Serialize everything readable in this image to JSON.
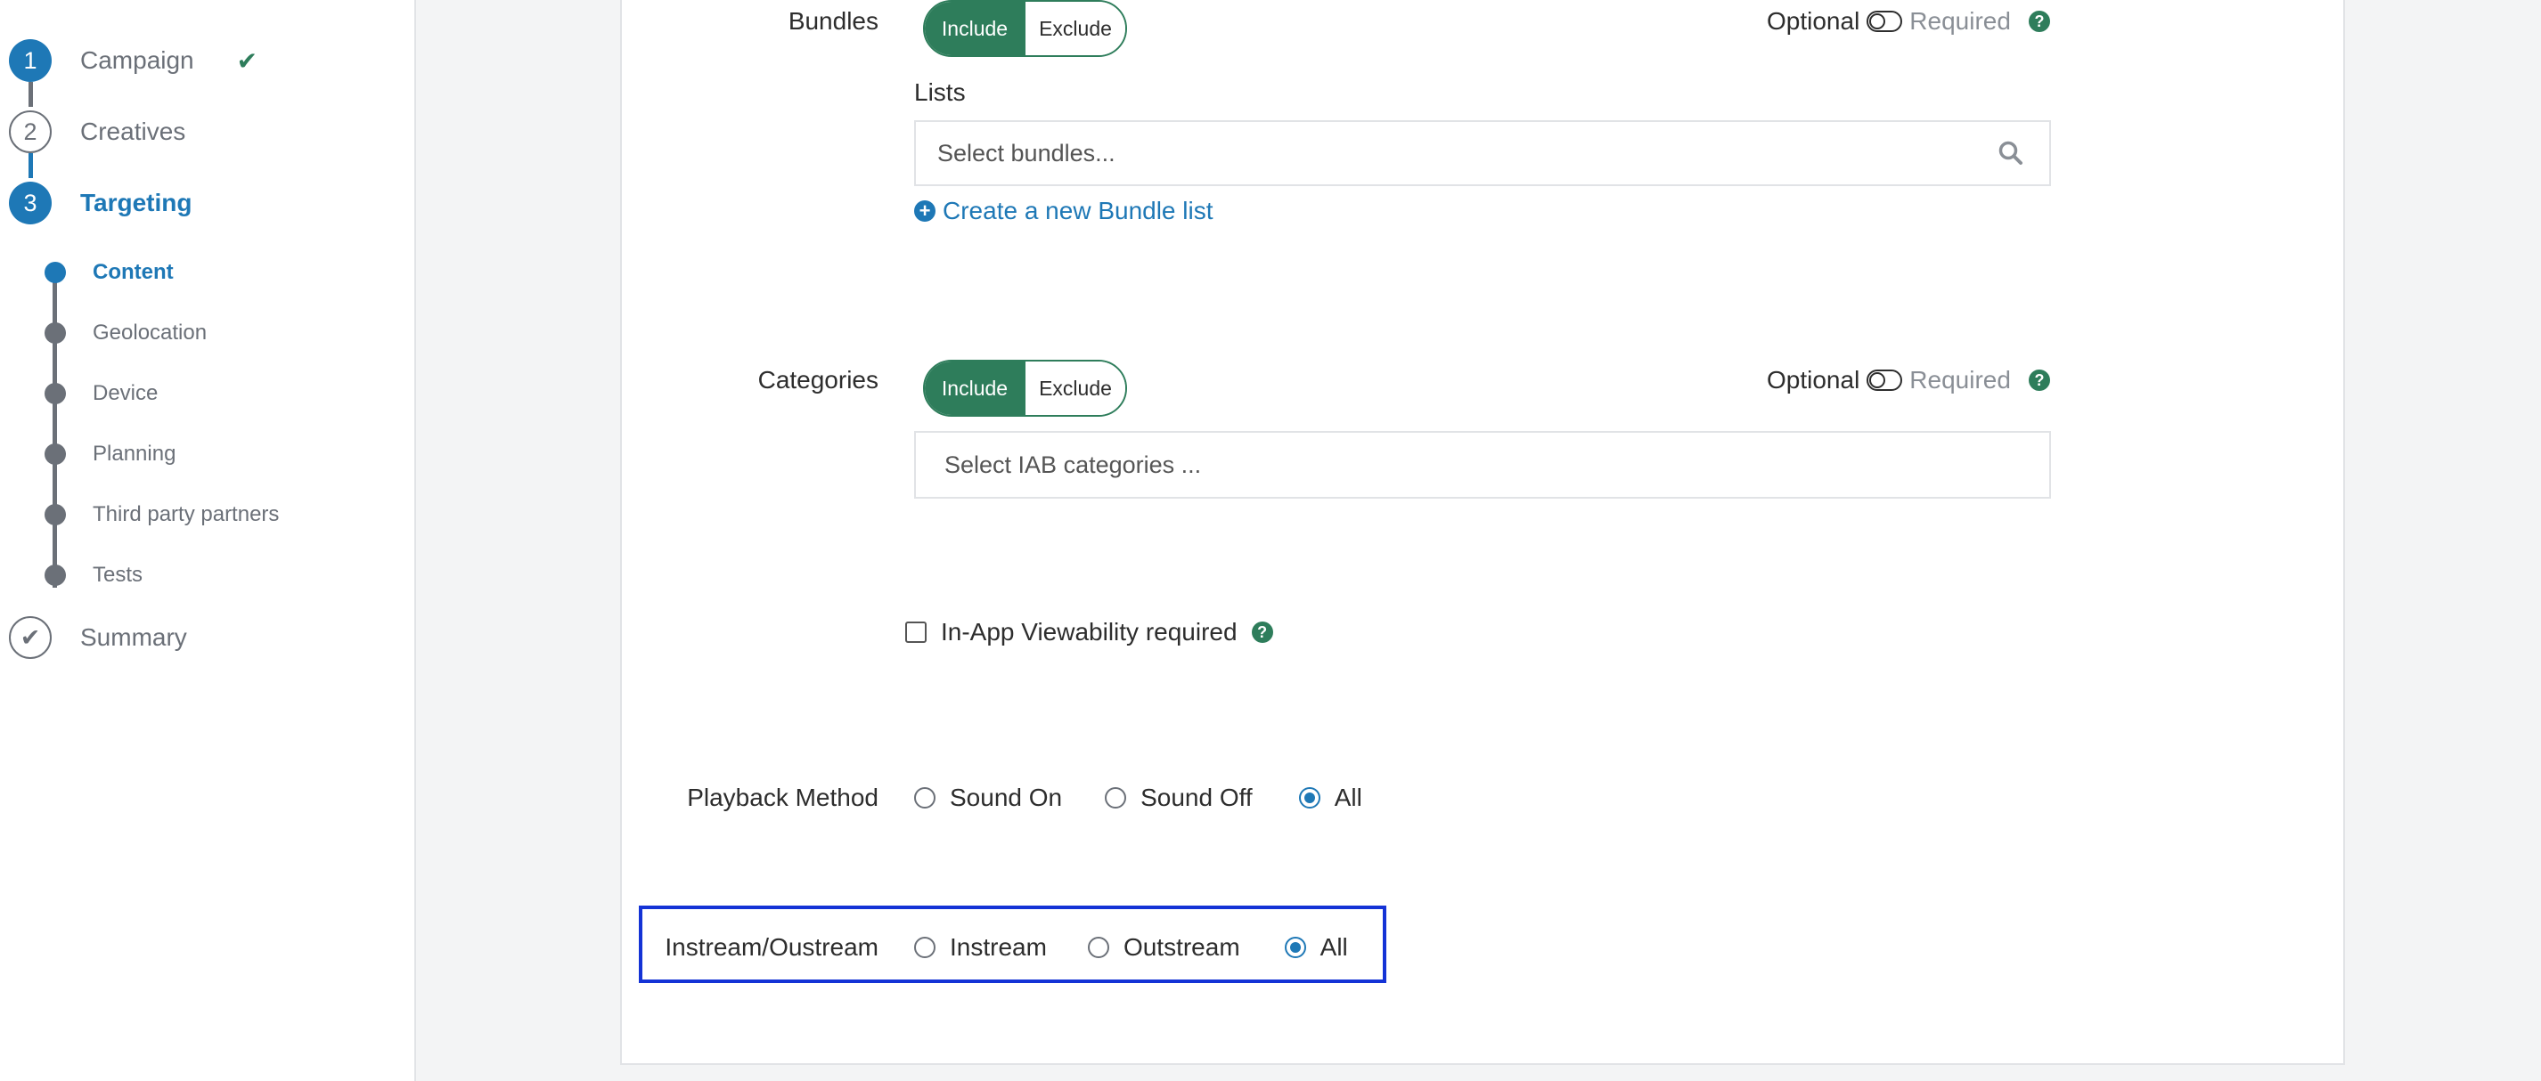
{
  "sidebar": {
    "steps": [
      {
        "number": "1",
        "label": "Campaign",
        "completed": true
      },
      {
        "number": "2",
        "label": "Creatives"
      },
      {
        "number": "3",
        "label": "Targeting",
        "active": true
      },
      {
        "label": "Summary",
        "icon": "check-icon"
      }
    ],
    "substeps": [
      {
        "label": "Content",
        "active": true
      },
      {
        "label": "Geolocation"
      },
      {
        "label": "Device"
      },
      {
        "label": "Planning"
      },
      {
        "label": "Third party partners"
      },
      {
        "label": "Tests"
      }
    ]
  },
  "content": {
    "bundles": {
      "label": "Bundles",
      "include_label": "Include",
      "exclude_label": "Exclude",
      "selected": "Include",
      "optional_label": "Optional",
      "required_label": "Required",
      "lists_label": "Lists",
      "select_placeholder": "Select bundles...",
      "create_link": "Create a new Bundle list"
    },
    "categories": {
      "label": "Categories",
      "include_label": "Include",
      "exclude_label": "Exclude",
      "selected": "Include",
      "optional_label": "Optional",
      "required_label": "Required",
      "select_placeholder": "Select IAB categories ..."
    },
    "viewability": {
      "label": "In-App Viewability required",
      "checked": false
    },
    "playback": {
      "label": "Playback Method",
      "options": [
        "Sound On",
        "Sound Off",
        "All"
      ],
      "selected": "All"
    },
    "instream": {
      "label": "Instream/Oustream",
      "options": [
        "Instream",
        "Outstream",
        "All"
      ],
      "selected": "All"
    }
  },
  "colors": {
    "accent_blue": "#1e78b6",
    "accent_green": "#2e7d5b",
    "highlight_border": "#1433d6",
    "muted_grey": "#6b7078"
  }
}
